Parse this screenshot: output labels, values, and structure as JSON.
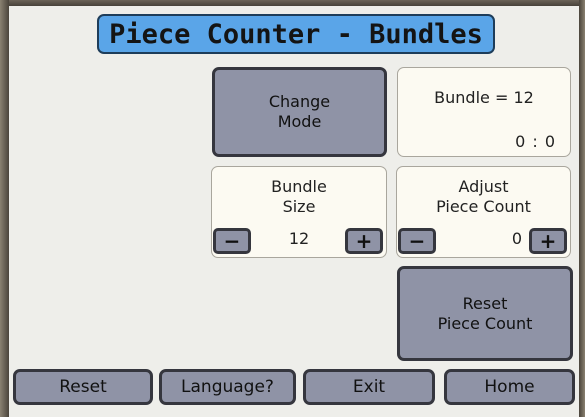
{
  "title": "Piece Counter - Bundles",
  "change_mode": {
    "line1": "Change",
    "line2": "Mode"
  },
  "bundle_status": {
    "label": "Bundle = 12",
    "time": "0 : 0"
  },
  "bundle_size": {
    "line1": "Bundle",
    "line2": "Size",
    "value": "12",
    "minus": "−",
    "plus": "+"
  },
  "adjust_piece_count": {
    "line1": "Adjust",
    "line2": "Piece Count",
    "value": "0",
    "minus": "−",
    "plus": "+"
  },
  "reset_piece_count": {
    "line1": "Reset",
    "line2": "Piece Count"
  },
  "bottom_bar": {
    "reset": "Reset",
    "language": "Language?",
    "exit": "Exit",
    "home": "Home"
  },
  "colors": {
    "title_bg": "#5aa5e8",
    "button_bg": "#8f93a6",
    "panel_bg": "#fcfaf2",
    "screen_bg": "#eeeeea"
  }
}
